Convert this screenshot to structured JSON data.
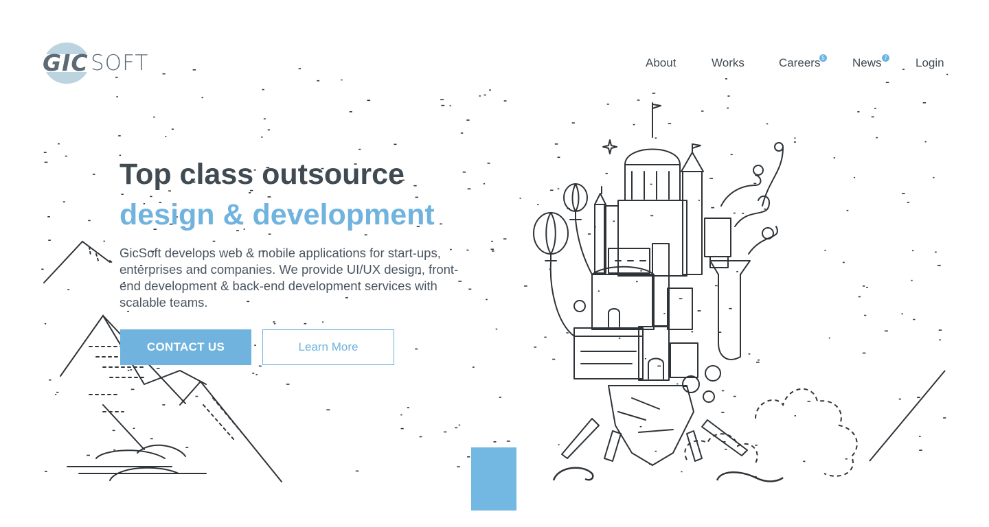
{
  "brand": {
    "logo_primary": "GIC",
    "logo_secondary": "SOFT",
    "colors": {
      "accent": "#6fb3de",
      "text": "#3f4a52",
      "logo": "#5b6a74"
    }
  },
  "nav": {
    "items": [
      {
        "label": "About"
      },
      {
        "label": "Works"
      },
      {
        "label": "Careers",
        "badge": "5"
      },
      {
        "label": "News",
        "badge": "7"
      },
      {
        "label": "Login"
      }
    ]
  },
  "hero": {
    "title": "Top class outsource",
    "subtitle": "design & development",
    "description": "GicSoft develops web & mobile applications for start-ups, enterprises and companies. We provide UI/UX design, front-end development & back-end development services with scalable teams.",
    "primary_button": "CONTACT US",
    "secondary_button": "Learn More"
  },
  "illustrations": {
    "left": "mountains-line-art",
    "right": "floating-castle-island-line-art"
  }
}
